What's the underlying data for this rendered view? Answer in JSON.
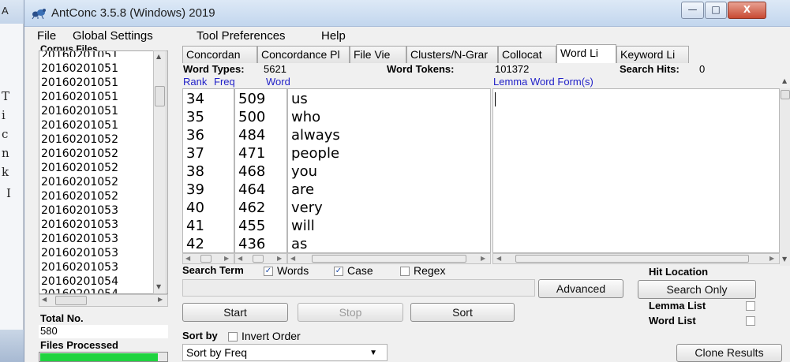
{
  "window": {
    "title": "AntConc 3.5.8 (Windows) 2019",
    "min_symbol": "—",
    "max_symbol": "□",
    "close_symbol": "X"
  },
  "background_window": {
    "title_fragment": "A",
    "side_letters": [
      "T",
      "i",
      "c",
      "n",
      "k",
      "I"
    ]
  },
  "menu": [
    "File",
    "Global Settings",
    "Tool Preferences",
    "Help"
  ],
  "corpus": {
    "title": "Corpus Files",
    "files": [
      "20160201051",
      "20160201051",
      "20160201051",
      "20160201051",
      "20160201051",
      "20160201052",
      "20160201052",
      "20160201052",
      "20160201052",
      "20160201052",
      "20160201053",
      "20160201053",
      "20160201053",
      "20160201053",
      "20160201053",
      "20160201054",
      "20160201054"
    ],
    "total_label": "Total No.",
    "total_value": "580",
    "processed_label": "Files Processed",
    "processed_fraction": 0.93
  },
  "tabs": [
    {
      "label": "Concordan",
      "active": false
    },
    {
      "label": "Concordance Pl",
      "active": false
    },
    {
      "label": "File Vie",
      "active": false
    },
    {
      "label": "Clusters/N-Grar",
      "active": false
    },
    {
      "label": "Collocat",
      "active": false
    },
    {
      "label": "Word Li",
      "active": true
    },
    {
      "label": "Keyword Li",
      "active": false
    }
  ],
  "wordlist": {
    "types_label": "Word Types:",
    "types_value": "5621",
    "tokens_label": "Word Tokens:",
    "tokens_value": "101372",
    "hits_label": "Search Hits:",
    "hits_value": "0",
    "columns": {
      "rank": "Rank",
      "freq": "Freq",
      "word": "Word",
      "lemma": "Lemma Word Form(s)"
    },
    "rows": [
      {
        "rank": "34",
        "freq": "509",
        "word": "us"
      },
      {
        "rank": "35",
        "freq": "500",
        "word": "who"
      },
      {
        "rank": "36",
        "freq": "484",
        "word": "always"
      },
      {
        "rank": "37",
        "freq": "471",
        "word": "people"
      },
      {
        "rank": "38",
        "freq": "468",
        "word": "you"
      },
      {
        "rank": "39",
        "freq": "464",
        "word": "are"
      },
      {
        "rank": "40",
        "freq": "462",
        "word": "very"
      },
      {
        "rank": "41",
        "freq": "455",
        "word": "will"
      },
      {
        "rank": "42",
        "freq": "436",
        "word": "as"
      }
    ]
  },
  "search": {
    "label": "Search Term",
    "words_label": "Words",
    "words_checked": true,
    "case_label": "Case",
    "case_checked": true,
    "regex_label": "Regex",
    "regex_checked": false,
    "value": "",
    "advanced_label": "Advanced",
    "start_label": "Start",
    "stop_label": "Stop",
    "sort_label": "Sort"
  },
  "hit_location": {
    "label": "Hit Location",
    "button_label": "Search Only",
    "lemma_list_label": "Lemma List",
    "word_list_label": "Word List"
  },
  "sort": {
    "label": "Sort by",
    "invert_label": "Invert Order",
    "invert_checked": false,
    "selected": "Sort by Freq"
  },
  "clone_label": "Clone Results",
  "colors": {
    "column_header": "#2222c8",
    "progress": "#1fd33f",
    "close_button": "#c84a33"
  }
}
